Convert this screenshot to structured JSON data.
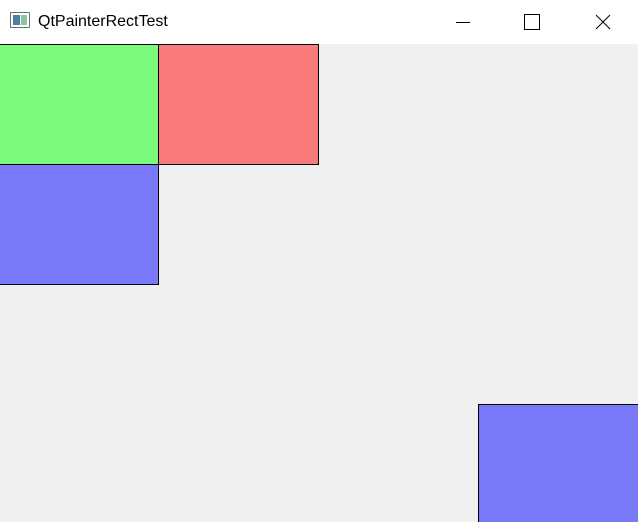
{
  "window": {
    "title": "QtPainterRectTest",
    "icon": "qt-app-icon",
    "buttons": {
      "minimize_icon": "minimize-icon",
      "maximize_icon": "maximize-icon",
      "close_icon": "close-icon"
    }
  },
  "canvas": {
    "background": "#f0f0f0",
    "rectangles": [
      {
        "name": "green",
        "fill": "#7afa7a",
        "stroke": "#000000"
      },
      {
        "name": "red",
        "fill": "#f87a7a",
        "stroke": "#000000"
      },
      {
        "name": "blue",
        "fill": "#7878f8",
        "stroke": "#000000"
      },
      {
        "name": "blue",
        "fill": "#7878f8",
        "stroke": "#000000"
      }
    ]
  }
}
